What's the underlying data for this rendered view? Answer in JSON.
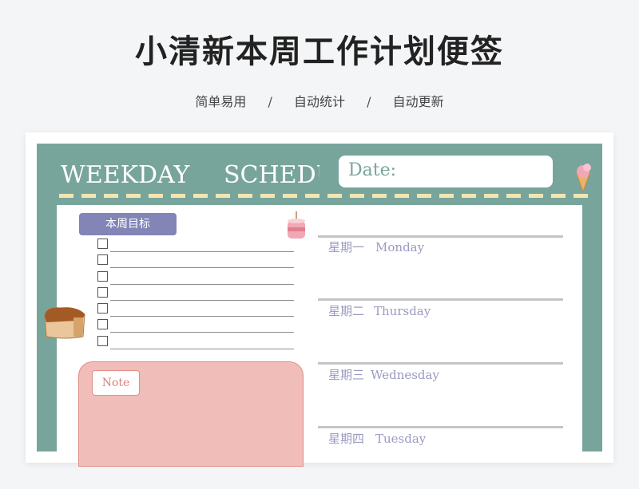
{
  "header": {
    "title": "小清新本周工作计划便签",
    "features": [
      "简单易用",
      "自动统计",
      "自动更新"
    ],
    "separator": "/"
  },
  "note_card": {
    "banner_left": "WEEKDAY",
    "banner_right": "SCHEDUI",
    "date_label": "Date:",
    "goals_label": "本周目标",
    "checkbox_count": 7,
    "note_label": "Note",
    "days": [
      {
        "cn": "星期一",
        "en": "Monday"
      },
      {
        "cn": "星期二",
        "en": "Thursday"
      },
      {
        "cn": "星期三",
        "en": "Wednesday"
      },
      {
        "cn": "星期四",
        "en": "Tuesday"
      }
    ]
  },
  "colors": {
    "teal": "#78a59b",
    "goal_tag": "#8285b6",
    "note_pink": "#f1bdb8",
    "dash": "#f3e5b3",
    "day_text": "#9a9ac2"
  },
  "decorations": [
    "ice-cream-icon",
    "cake-icon",
    "bread-icon"
  ]
}
